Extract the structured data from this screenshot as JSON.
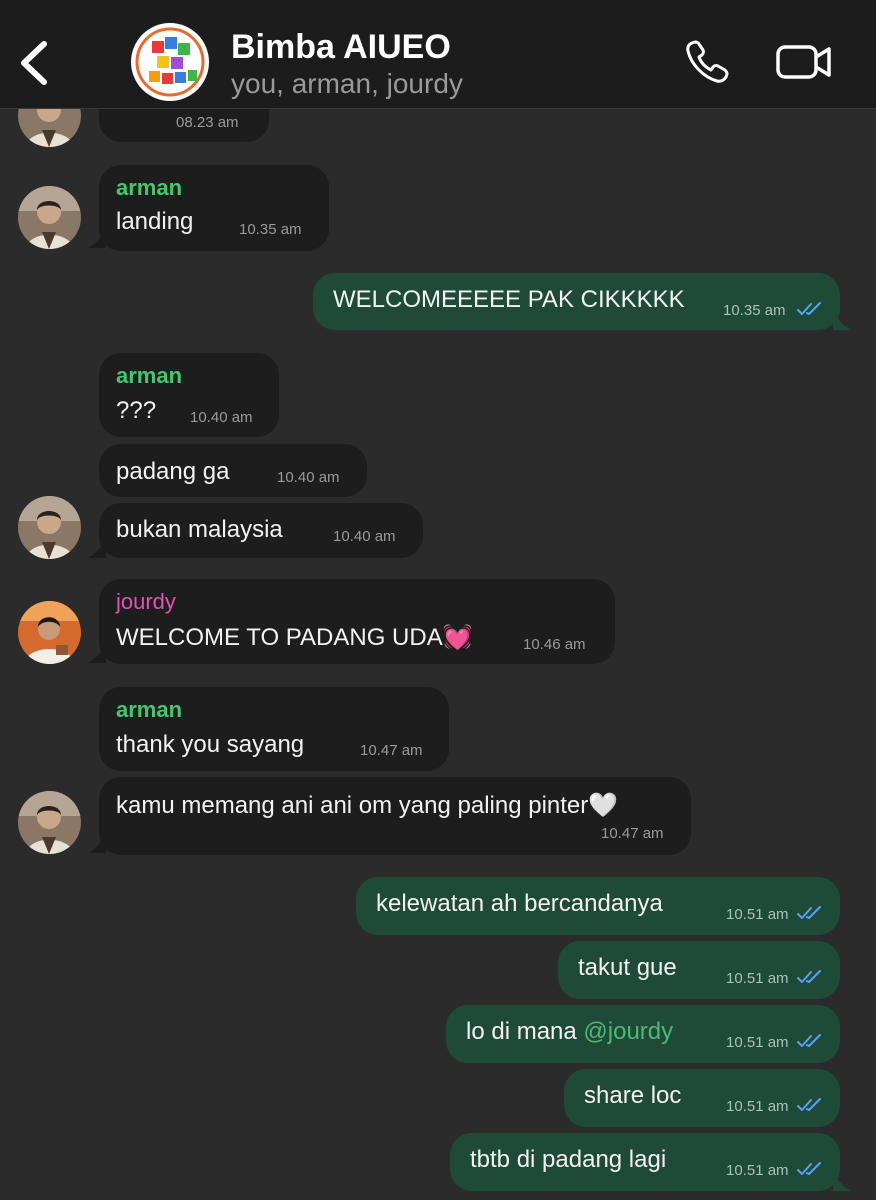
{
  "header": {
    "title": "Bimba AIUEO",
    "subtitle": "you, arman, jourdy"
  },
  "colors": {
    "header_bg": "#1c1c1c",
    "chat_bg": "#2b2b2b",
    "incoming_bubble": "#1d1d1d",
    "outgoing_bubble": "#1f4a37",
    "arman_name": "#45c76f",
    "jourdy_name": "#e052b6",
    "read_ticks": "#53a6f4"
  },
  "messages": [
    {
      "time": "08.23 am"
    },
    {
      "sender": "arman",
      "text": "landing",
      "time": "10.35 am"
    },
    {
      "text": "WELCOMEEEEE PAK CIKKKKK",
      "time": "10.35 am",
      "status": "read"
    },
    {
      "sender": "arman",
      "text": "???",
      "time": "10.40 am"
    },
    {
      "text": "padang ga",
      "time": "10.40 am"
    },
    {
      "text": "bukan malaysia",
      "time": "10.40 am"
    },
    {
      "sender": "jourdy",
      "text": "WELCOME TO PADANG UDA💓",
      "time": "10.46 am"
    },
    {
      "sender": "arman",
      "text": "thank you sayang",
      "time": "10.47 am"
    },
    {
      "text": "kamu memang ani ani om yang paling pinter🤍",
      "time": "10.47 am"
    },
    {
      "text": "kelewatan ah bercandanya",
      "time": "10.51 am",
      "status": "read"
    },
    {
      "text": "takut gue",
      "time": "10.51 am",
      "status": "read"
    },
    {
      "text": "lo di mana ",
      "mention": "@jourdy",
      "time": "10.51 am",
      "status": "read"
    },
    {
      "text": "share loc",
      "time": "10.51 am",
      "status": "read"
    },
    {
      "text": "tbtb di padang lagi",
      "time": "10.51 am",
      "status": "read"
    }
  ]
}
